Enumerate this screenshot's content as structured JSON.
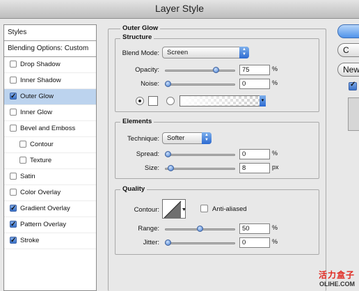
{
  "window": {
    "title": "Layer Style"
  },
  "styles_panel": {
    "header": "Styles",
    "blending": "Blending Options: Custom",
    "items": [
      {
        "label": "Drop Shadow",
        "checked": false,
        "indent": false,
        "selected": false
      },
      {
        "label": "Inner Shadow",
        "checked": false,
        "indent": false,
        "selected": false
      },
      {
        "label": "Outer Glow",
        "checked": true,
        "indent": false,
        "selected": true
      },
      {
        "label": "Inner Glow",
        "checked": false,
        "indent": false,
        "selected": false
      },
      {
        "label": "Bevel and Emboss",
        "checked": false,
        "indent": false,
        "selected": false
      },
      {
        "label": "Contour",
        "checked": false,
        "indent": true,
        "selected": false
      },
      {
        "label": "Texture",
        "checked": false,
        "indent": true,
        "selected": false
      },
      {
        "label": "Satin",
        "checked": false,
        "indent": false,
        "selected": false
      },
      {
        "label": "Color Overlay",
        "checked": false,
        "indent": false,
        "selected": false
      },
      {
        "label": "Gradient Overlay",
        "checked": true,
        "indent": false,
        "selected": false
      },
      {
        "label": "Pattern Overlay",
        "checked": true,
        "indent": false,
        "selected": false
      },
      {
        "label": "Stroke",
        "checked": true,
        "indent": false,
        "selected": false
      }
    ]
  },
  "outer_glow": {
    "title": "Outer Glow",
    "structure": {
      "title": "Structure",
      "blend_mode_label": "Blend Mode:",
      "blend_mode_value": "Screen",
      "opacity_label": "Opacity:",
      "opacity_value": "75",
      "opacity_unit": "%",
      "opacity_level": 0.75,
      "noise_label": "Noise:",
      "noise_value": "0",
      "noise_unit": "%",
      "noise_level": 0
    },
    "elements": {
      "title": "Elements",
      "technique_label": "Technique:",
      "technique_value": "Softer",
      "spread_label": "Spread:",
      "spread_value": "0",
      "spread_unit": "%",
      "spread_level": 0,
      "size_label": "Size:",
      "size_value": "8",
      "size_unit": "px",
      "size_level": 0.04
    },
    "quality": {
      "title": "Quality",
      "contour_label": "Contour:",
      "anti_aliased_label": "Anti-aliased",
      "range_label": "Range:",
      "range_value": "50",
      "range_unit": "%",
      "range_level": 0.5,
      "jitter_label": "Jitter:",
      "jitter_value": "0",
      "jitter_unit": "%",
      "jitter_level": 0
    }
  },
  "buttons": {
    "new_style_label": "New"
  },
  "watermark": {
    "cn": "活力盒子",
    "en": "OLIHE.COM"
  }
}
